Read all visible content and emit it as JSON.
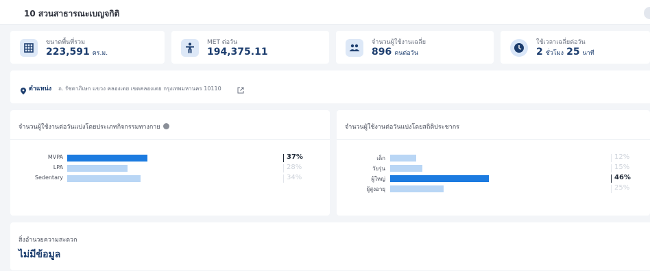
{
  "header": {
    "title": "10 สวนสาธารณะเบญจกิติ"
  },
  "stats": [
    {
      "label": "ขนาดพื้นที่รวม",
      "value": "223,591",
      "unit": "ตร.ม.",
      "icon": "grid-icon"
    },
    {
      "label": "MET ต่อวัน",
      "value": "194,375.11",
      "unit": "",
      "icon": "person-icon"
    },
    {
      "label": "จำนวนผู้ใช้งานเฉลี่ย",
      "value": "896",
      "unit": "คนต่อวัน",
      "icon": "people-icon"
    },
    {
      "label": "ใช้เวลาเฉลี่ยต่อวัน",
      "hours": "2",
      "hours_unit": "ชั่วโมง",
      "minutes": "25",
      "minutes_unit": "นาที",
      "icon": "clock-icon"
    }
  ],
  "location": {
    "label": "ตำแหน่ง",
    "address": "ถ. รัชดาภิเษก แขวง คลองเตย เขตคลองเตย กรุงเทพมหานคร 10110"
  },
  "activity_chart": {
    "title": "จำนวนผู้ใช้งานต่อวันแบ่งโดยประเภทกิจกรรมทางกาย",
    "rows": [
      {
        "label": "MVPA",
        "value": 37,
        "pct_text": "37%"
      },
      {
        "label": "LPA",
        "value": 28,
        "pct_text": "28%"
      },
      {
        "label": "Sedentary",
        "value": 34,
        "pct_text": "34%"
      }
    ]
  },
  "demographic_chart": {
    "title": "จำนวนผู้ใช้งานต่อวันแบ่งโดยสถิติประชากร",
    "rows": [
      {
        "label": "เด็ก",
        "value": 12,
        "pct_text": "12%"
      },
      {
        "label": "วัยรุ่น",
        "value": 15,
        "pct_text": "15%"
      },
      {
        "label": "ผู้ใหญ่",
        "value": 46,
        "pct_text": "46%"
      },
      {
        "label": "ผู้สูงอายุ",
        "value": 25,
        "pct_text": "25%"
      }
    ]
  },
  "facilities": {
    "label": "สิ่งอำนวยความสะดวก",
    "value": "ไม่มีข้อมูล"
  },
  "colors": {
    "accent": "#1c7be0",
    "light_bar": "#b9d6f5",
    "dark_text": "#1c3d6e",
    "icon_bg": "#dde8f7"
  }
}
